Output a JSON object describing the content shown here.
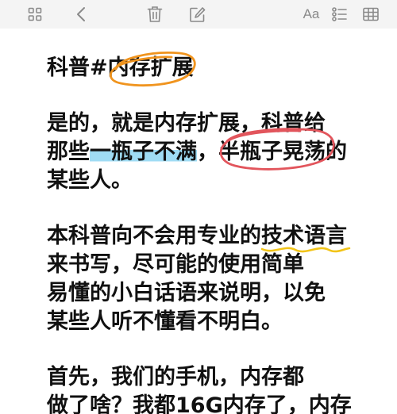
{
  "toolbar": {
    "left_icons": [
      "grid-icon",
      "back-arrow-icon"
    ],
    "center_icons": [
      "trash-icon",
      "edit-icon"
    ],
    "font_label": "Aa",
    "right_icons": [
      "checklist-icon",
      "table-icon"
    ],
    "icon_color": "#8a8a8a"
  },
  "note": {
    "title": {
      "pre": "科普#",
      "circled": "内存扩展"
    },
    "p1": {
      "line1": "是的，就是内存扩展，科普给",
      "line2": {
        "pre": "那些",
        "highlighted": "一瓶子不满",
        "mid": "，",
        "circled": "半瓶子晃荡",
        "post": "的"
      },
      "line3": "某些人。"
    },
    "p2": {
      "line1": {
        "pre": "本科普向不会用专业的",
        "underlined": "技术语言"
      },
      "line2": "来书写，尽可能的使用简单",
      "line3": "易懂的小白话语来说明，以免",
      "line4": "某些人听不懂看不明白。"
    },
    "p3": {
      "line1": "首先，我们的手机，内存都",
      "line2": "做了啥？我都16G内存了，内存"
    }
  },
  "colors": {
    "text": "#111111",
    "toolbar_bg": "#f4f4f4",
    "orange_circle": "#f0941e",
    "red_circle": "#e2555c",
    "blue_highlight": "#9fdcf4",
    "yellow_underline": "#f2c418"
  }
}
